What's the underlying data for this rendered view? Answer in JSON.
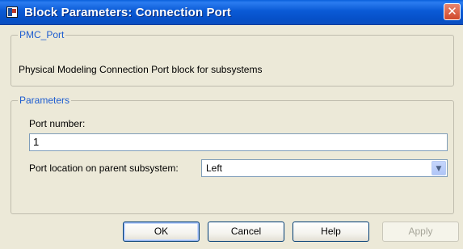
{
  "window": {
    "title": "Block Parameters: Connection Port",
    "close_glyph": "✕"
  },
  "block_group": {
    "legend": "PMC_Port",
    "description": "Physical Modeling Connection Port block for subsystems"
  },
  "parameters_group": {
    "legend": "Parameters",
    "port_number_label": "Port number:",
    "port_number_value": "1",
    "port_location_label": "Port location on parent subsystem:",
    "port_location_value": "Left",
    "dropdown_arrow_glyph": "▼"
  },
  "buttons": {
    "ok": "OK",
    "cancel": "Cancel",
    "help": "Help",
    "apply": "Apply"
  }
}
